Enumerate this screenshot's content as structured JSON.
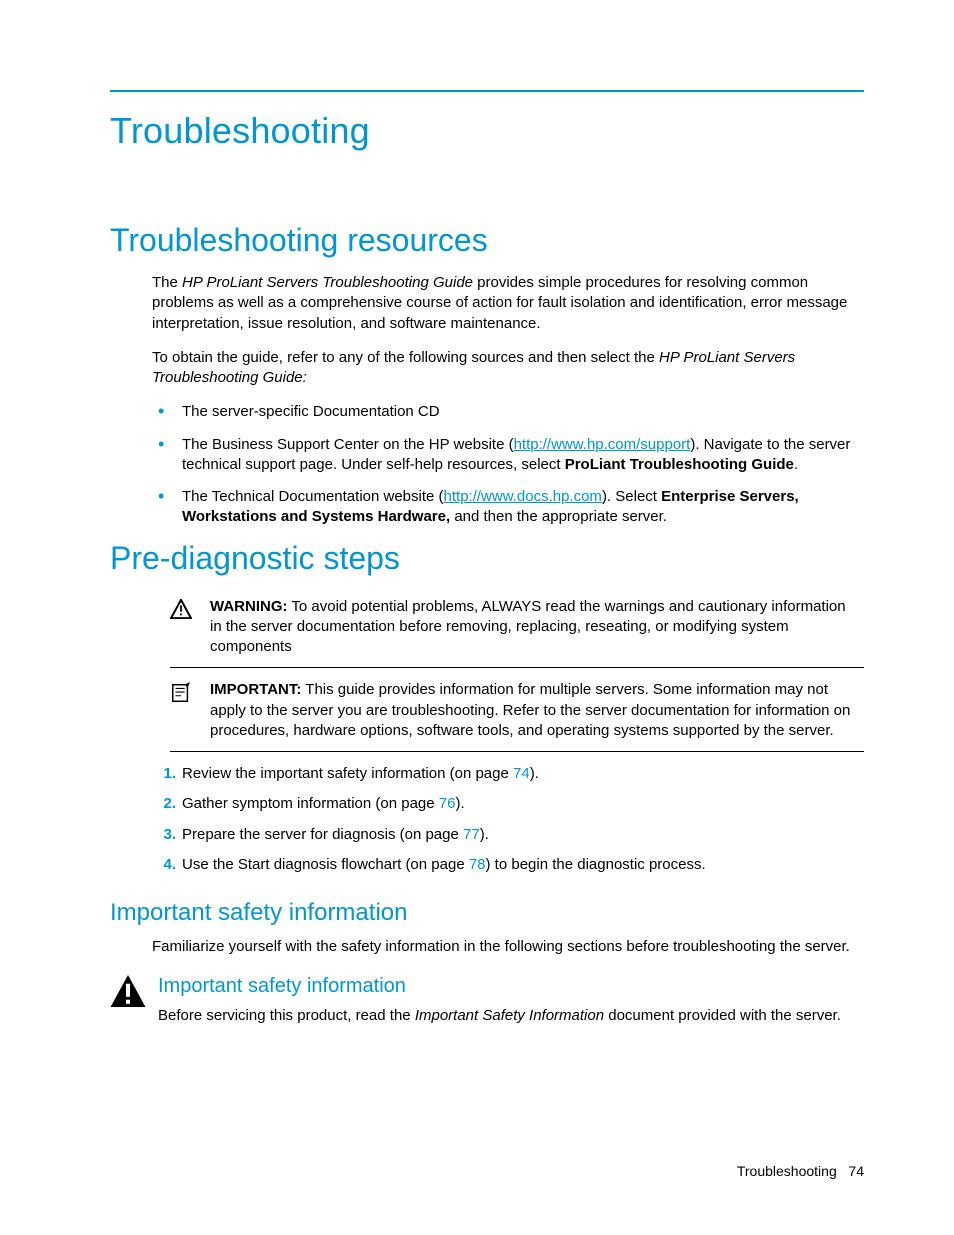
{
  "title": "Troubleshooting",
  "sections": {
    "resources": {
      "heading": "Troubleshooting resources",
      "p1a": "The ",
      "p1b": "HP ProLiant Servers Troubleshooting Guide",
      "p1c": " provides simple procedures for resolving common problems as well as a comprehensive course of action for fault isolation and identification, error message interpretation, issue resolution, and software maintenance.",
      "p2a": "To obtain the guide, refer to any of the following sources and then select the ",
      "p2b": "HP ProLiant Servers Troubleshooting Guide:",
      "bullets": {
        "b1": "The server-specific Documentation CD",
        "b2a": "The Business Support Center on the HP website (",
        "b2link": "http://www.hp.com/support",
        "b2b": "). Navigate to the server technical support page. Under self-help resources, select ",
        "b2c": "ProLiant Troubleshooting Guide",
        "b2d": ".",
        "b3a": "The Technical Documentation website (",
        "b3link": "http://www.docs.hp.com",
        "b3b": "). Select ",
        "b3c": "Enterprise Servers, Workstations and Systems Hardware,",
        "b3d": " and then the appropriate server."
      }
    },
    "prediag": {
      "heading": "Pre-diagnostic steps",
      "warning": {
        "label": "WARNING:",
        "text": "  To avoid potential problems, ALWAYS read the warnings and cautionary information in the server documentation before removing, replacing, reseating, or modifying system components"
      },
      "important": {
        "label": "IMPORTANT:",
        "text": "  This guide provides information for multiple servers. Some information may not apply to the server you are troubleshooting. Refer to the server documentation for information on procedures, hardware options, software tools, and operating systems supported by the server."
      },
      "steps": {
        "s1a": "Review the important safety information (on page ",
        "s1p": "74",
        "s1b": ").",
        "s2a": "Gather symptom information (on page ",
        "s2p": "76",
        "s2b": ").",
        "s3a": "Prepare the server for diagnosis (on page ",
        "s3p": "77",
        "s3b": ").",
        "s4a": "Use the Start diagnosis flowchart (on page ",
        "s4p": "78",
        "s4b": ") to begin the diagnostic process."
      }
    },
    "safety": {
      "heading": "Important safety information",
      "p1": "Familiarize yourself with the safety information in the following sections before troubleshooting the server.",
      "sub": {
        "heading": "Important safety information",
        "p1a": "Before servicing this product, read the ",
        "p1b": "Important Safety Information",
        "p1c": " document provided with the server."
      }
    }
  },
  "footer": {
    "section": "Troubleshooting",
    "page": "74"
  }
}
